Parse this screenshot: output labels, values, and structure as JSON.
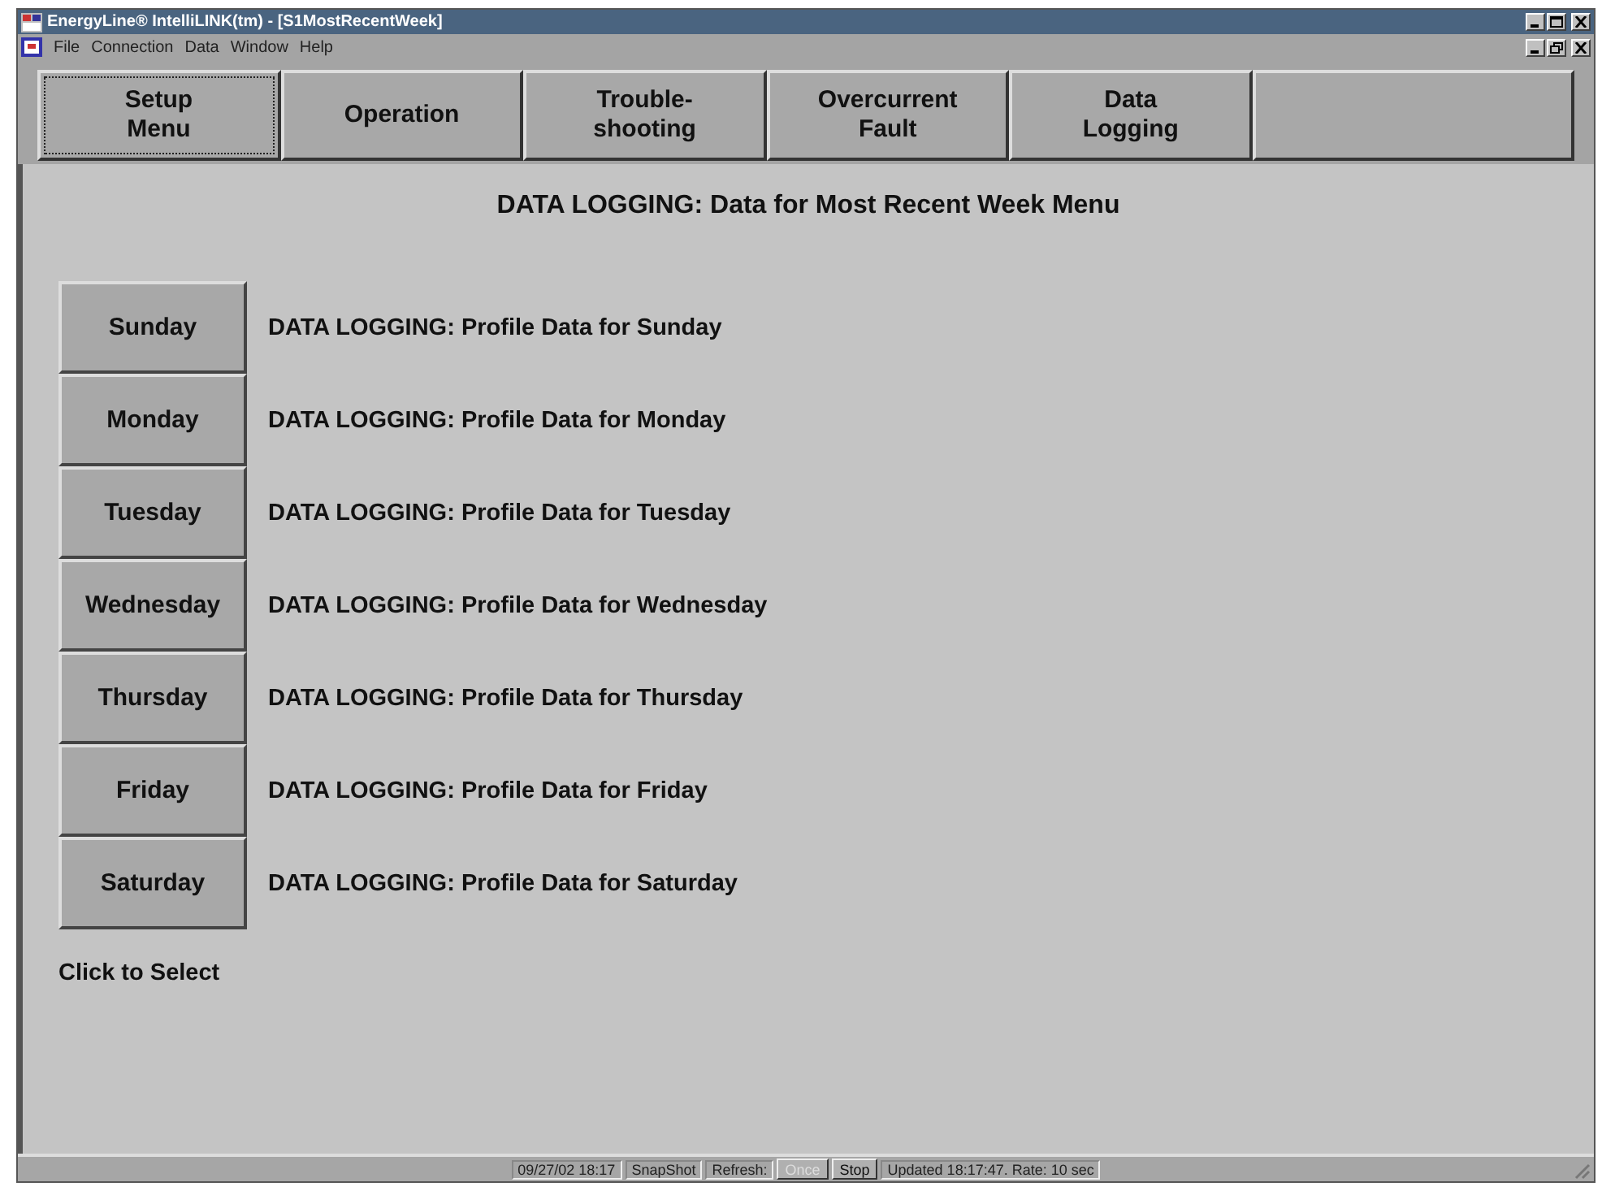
{
  "window": {
    "title": "EnergyLine® IntelliLINK(tm)  - [S1MostRecentWeek]"
  },
  "menu": [
    "File",
    "Connection",
    "Data",
    "Window",
    "Help"
  ],
  "toolbar": [
    {
      "lines": [
        "Setup",
        "Menu"
      ],
      "focused": true
    },
    {
      "lines": [
        "Operation"
      ],
      "focused": false
    },
    {
      "lines": [
        "Trouble-",
        "shooting"
      ],
      "focused": false
    },
    {
      "lines": [
        "Overcurrent",
        "Fault"
      ],
      "focused": false
    },
    {
      "lines": [
        "Data",
        "Logging"
      ],
      "focused": false
    },
    {
      "focused": false
    }
  ],
  "heading": "DATA LOGGING: Data for Most Recent Week Menu",
  "days": [
    {
      "label": "Sunday",
      "description": "DATA LOGGING: Profile Data for Sunday"
    },
    {
      "label": "Monday",
      "description": "DATA LOGGING: Profile Data for Monday"
    },
    {
      "label": "Tuesday",
      "description": "DATA LOGGING: Profile Data for Tuesday"
    },
    {
      "label": "Wednesday",
      "description": "DATA LOGGING: Profile Data for Wednesday"
    },
    {
      "label": "Thursday",
      "description": "DATA LOGGING: Profile Data for Thursday"
    },
    {
      "label": "Friday",
      "description": "DATA LOGGING: Profile Data for Friday"
    },
    {
      "label": "Saturday",
      "description": "DATA LOGGING: Profile Data for Saturday"
    }
  ],
  "hint": "Click to Select",
  "status_bar": [
    {
      "kind": "panel",
      "text": "09/27/02 18:17"
    },
    {
      "kind": "panel",
      "text": "SnapShot"
    },
    {
      "kind": "panel",
      "text": "Refresh:"
    },
    {
      "kind": "button",
      "text": "Once",
      "disabled": true
    },
    {
      "kind": "button",
      "text": "Stop",
      "disabled": false
    },
    {
      "kind": "panel",
      "text": "Updated 18:17:47. Rate: 10 sec"
    }
  ]
}
